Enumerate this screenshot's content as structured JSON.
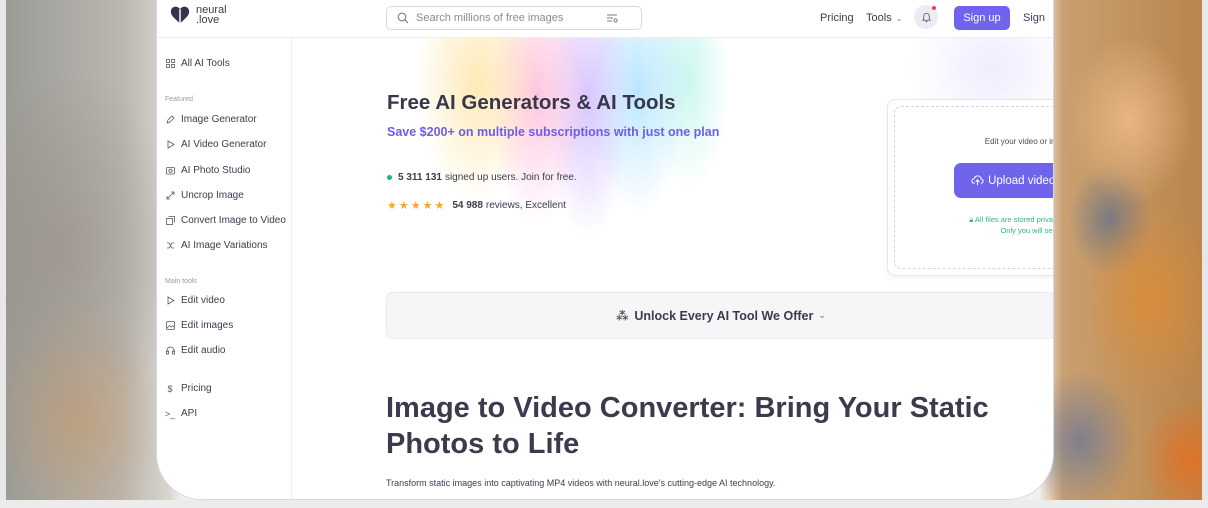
{
  "header": {
    "logo_line1": "neural",
    "logo_line2": ".love",
    "search_placeholder": "Search millions of free images",
    "pricing": "Pricing",
    "tools": "Tools",
    "signup": "Sign up",
    "signin": "Sign"
  },
  "sidebar": {
    "all_tools": "All AI Tools",
    "featured_heading": "Featured",
    "featured": [
      {
        "label": "Image Generator",
        "icon": "pen-nib-icon"
      },
      {
        "label": "AI Video Generator",
        "icon": "play-icon"
      },
      {
        "label": "AI Photo Studio",
        "icon": "camera-icon"
      },
      {
        "label": "Uncrop Image",
        "icon": "expand-icon"
      },
      {
        "label": "Convert Image to Video",
        "icon": "image-stack-icon"
      },
      {
        "label": "AI Image Variations",
        "icon": "shuffle-icon"
      }
    ],
    "main_heading": "Main tools",
    "main": [
      {
        "label": "Edit video",
        "icon": "play-icon"
      },
      {
        "label": "Edit images",
        "icon": "image-icon"
      },
      {
        "label": "Edit audio",
        "icon": "headphones-icon"
      }
    ],
    "bottom": [
      {
        "label": "Pricing",
        "icon": "dollar-icon"
      },
      {
        "label": "API",
        "icon": "terminal-icon"
      }
    ]
  },
  "hero": {
    "title": "Free AI Generators & AI Tools",
    "subtitle": "Save $200+ on multiple subscriptions with just one plan",
    "users_count": "5 311 131",
    "users_text": "signed up users. Join for free.",
    "reviews_count": "54 988",
    "reviews_text": "reviews, Excellent",
    "rating_stars": 5
  },
  "upload": {
    "hint": "Edit your video or images here",
    "button": "Upload video or images",
    "private_line1": "All files are stored privately & encrypted.",
    "private_line2": "Only you will see them."
  },
  "unlock": {
    "label": "Unlock Every AI Tool We Offer"
  },
  "article": {
    "title": "Image to Video Converter: Bring Your Static Photos to Life",
    "description": "Transform static images into captivating MP4 videos with neural.love's cutting-edge AI technology."
  },
  "colors": {
    "accent": "#6f63f0",
    "accent_text": "#6d5ee9",
    "success": "#1fb96b",
    "star": "#f5a623"
  }
}
